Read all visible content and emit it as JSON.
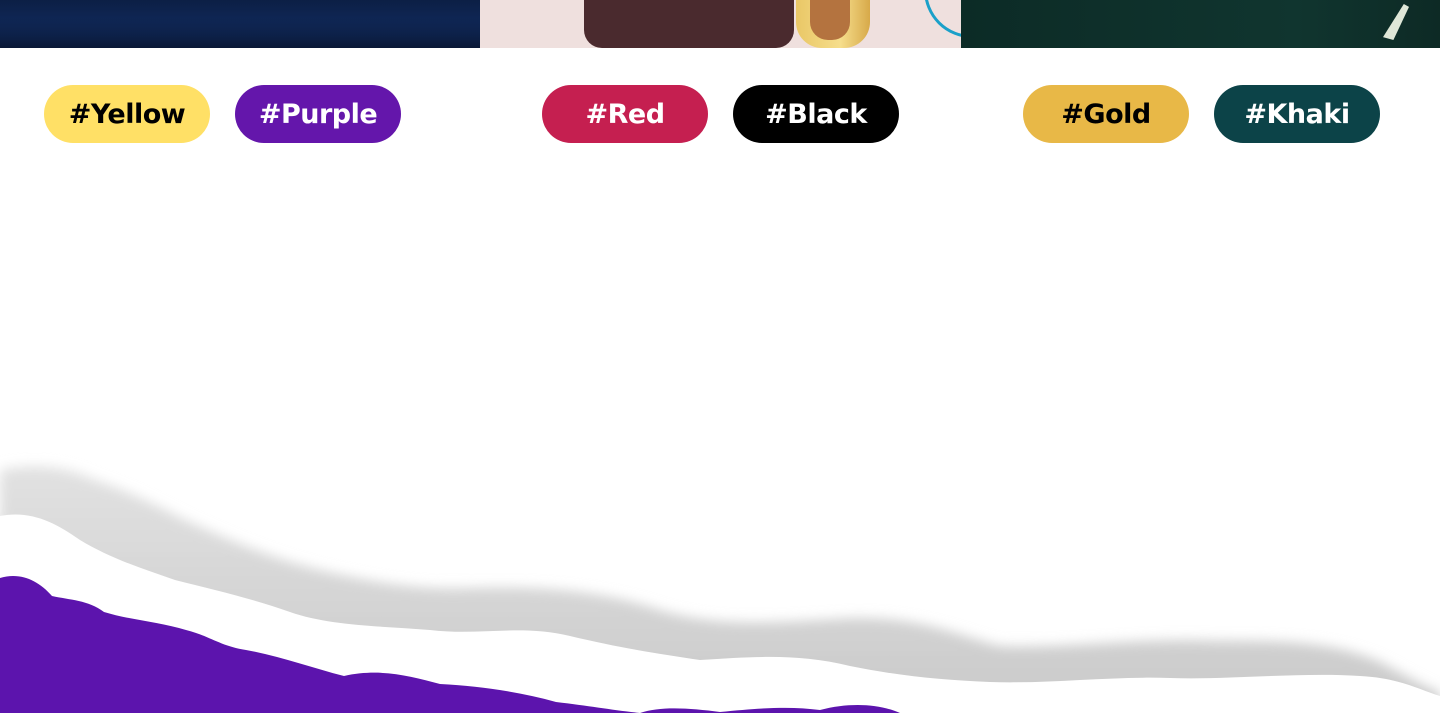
{
  "tags": [
    {
      "label": "#Yellow",
      "bg": "#ffe066",
      "fg": "#000000"
    },
    {
      "label": "#Purple",
      "bg": "#6416ab",
      "fg": "#ffffff"
    },
    {
      "label": "#Red",
      "bg": "#c51f50",
      "fg": "#ffffff"
    },
    {
      "label": "#Black",
      "bg": "#000000",
      "fg": "#ffffff"
    },
    {
      "label": "#Gold",
      "bg": "#e8b847",
      "fg": "#000000"
    },
    {
      "label": "#Khaki",
      "bg": "#0c4348",
      "fg": "#ffffff"
    }
  ],
  "colors": {
    "page_background": "#ffffff",
    "torn_paper_shadow": "#cfcfcf",
    "purple_band": "#5c14ad"
  }
}
